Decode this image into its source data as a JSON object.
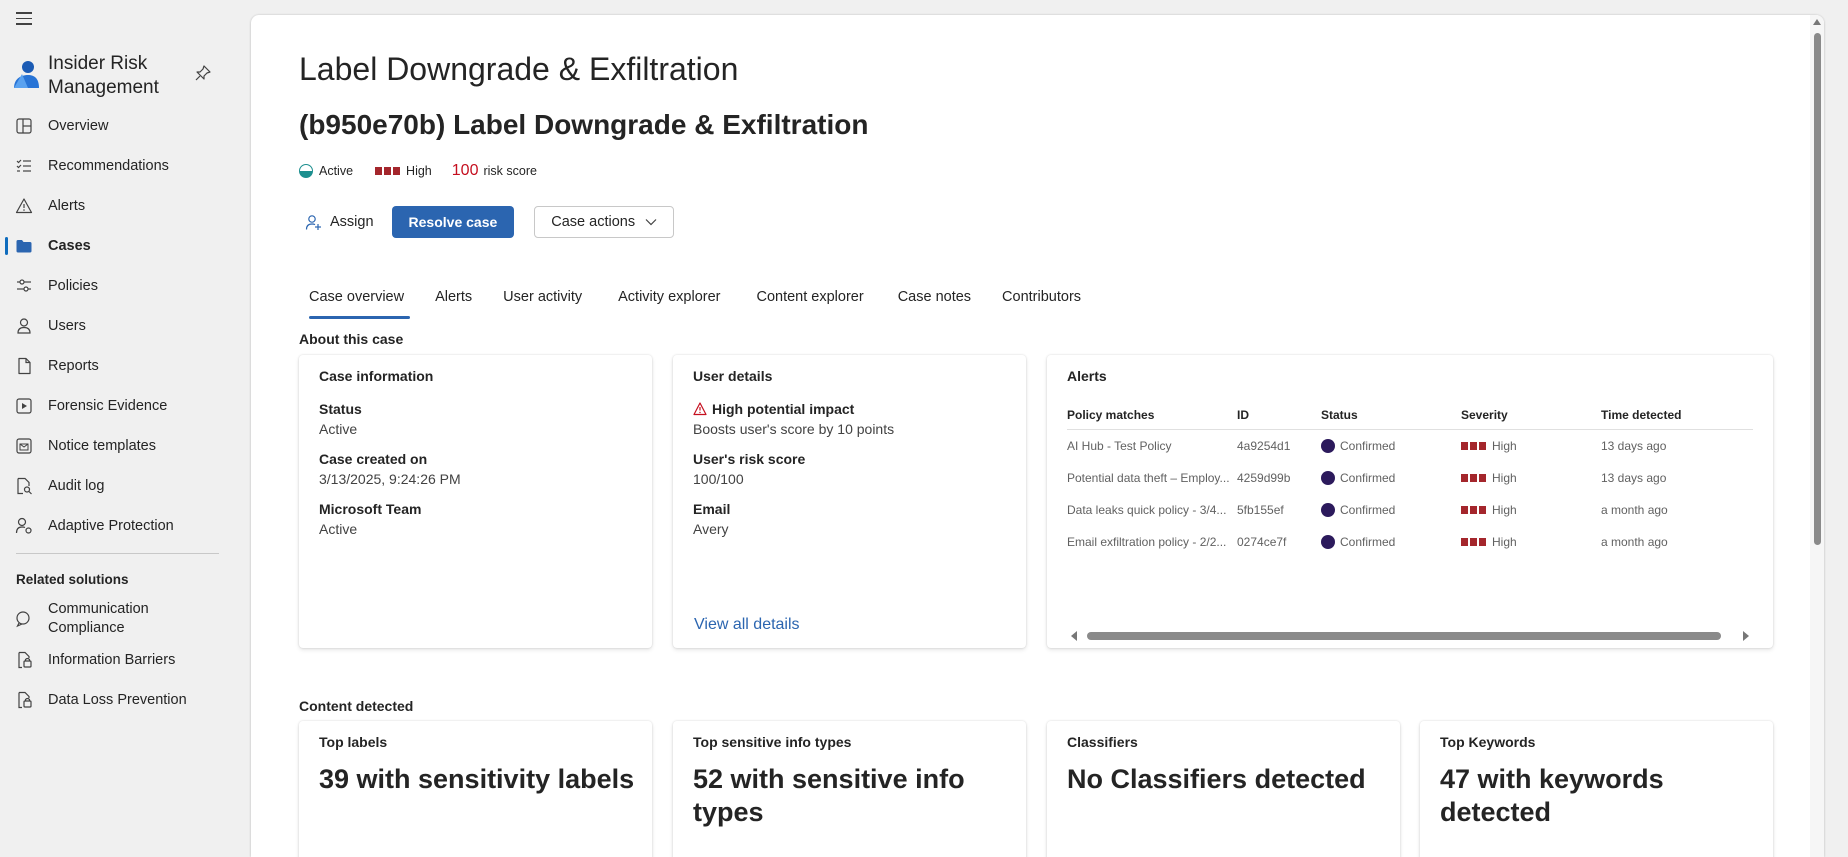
{
  "sidebar": {
    "app_title": "Insider Risk Management",
    "items": [
      {
        "label": "Overview",
        "icon": "overview-icon"
      },
      {
        "label": "Recommendations",
        "icon": "recommendations-icon"
      },
      {
        "label": "Alerts",
        "icon": "alert-triangle-icon"
      },
      {
        "label": "Cases",
        "icon": "folder-icon",
        "active": true
      },
      {
        "label": "Policies",
        "icon": "sliders-icon"
      },
      {
        "label": "Users",
        "icon": "person-icon"
      },
      {
        "label": "Reports",
        "icon": "document-icon"
      },
      {
        "label": "Forensic Evidence",
        "icon": "play-box-icon"
      },
      {
        "label": "Notice templates",
        "icon": "mail-template-icon"
      },
      {
        "label": "Audit log",
        "icon": "document-search-icon"
      },
      {
        "label": "Adaptive Protection",
        "icon": "person-settings-icon"
      }
    ],
    "related_heading": "Related solutions",
    "related": [
      {
        "label": "Communication Compliance",
        "icon": "chat-icon"
      },
      {
        "label": "Information Barriers",
        "icon": "lock-document-icon"
      },
      {
        "label": "Data Loss Prevention",
        "icon": "lock-document-icon"
      }
    ]
  },
  "page": {
    "title": "Label Downgrade & Exfiltration",
    "case_title": "(b950e70b) Label Downgrade & Exfiltration",
    "status": "Active",
    "severity": "High",
    "risk_score": "100",
    "risk_score_label": "risk score"
  },
  "actions": {
    "assign": "Assign",
    "resolve": "Resolve case",
    "case_actions": "Case actions"
  },
  "tabs": [
    "Case overview",
    "Alerts",
    "User activity",
    "Activity explorer",
    "Content explorer",
    "Case notes",
    "Contributors"
  ],
  "about": {
    "heading": "About this case",
    "case_info": {
      "title": "Case information",
      "status_label": "Status",
      "status_value": "Active",
      "created_label": "Case created on",
      "created_value": "3/13/2025, 9:24:26 PM",
      "team_label": "Microsoft Team",
      "team_value": "Active"
    },
    "user_details": {
      "title": "User details",
      "impact_label": "High potential impact",
      "impact_desc": "Boosts user's score by 10 points",
      "risk_label": "User's risk score",
      "risk_value": "100/100",
      "email_label": "Email",
      "email_value": "Avery",
      "view_all": "View all details"
    },
    "alerts": {
      "title": "Alerts",
      "columns": [
        "Policy matches",
        "ID",
        "Status",
        "Severity",
        "Time detected"
      ],
      "rows": [
        {
          "policy": "AI Hub - Test Policy",
          "id": "4a9254d1",
          "status": "Confirmed",
          "severity": "High",
          "time": "13 days ago"
        },
        {
          "policy": "Potential data theft – Employ...",
          "id": "4259d99b",
          "status": "Confirmed",
          "severity": "High",
          "time": "13 days ago"
        },
        {
          "policy": "Data leaks quick policy - 3/4...",
          "id": "5fb155ef",
          "status": "Confirmed",
          "severity": "High",
          "time": "a month ago"
        },
        {
          "policy": "Email exfiltration policy - 2/2...",
          "id": "0274ce7f",
          "status": "Confirmed",
          "severity": "High",
          "time": "a month ago"
        }
      ]
    }
  },
  "content": {
    "heading": "Content detected",
    "cards": [
      {
        "title": "Top labels",
        "value": "39 with sensitivity labels"
      },
      {
        "title": "Top sensitive info types",
        "value": "52 with sensitive info types"
      },
      {
        "title": "Classifiers",
        "value": "No Classifiers detected"
      },
      {
        "title": "Top Keywords",
        "value": "47 with keywords detected"
      }
    ]
  },
  "colors": {
    "accent": "#2b65b0",
    "severity_high": "#a4262c",
    "risk_score": "#c50f1f",
    "confirmed_dot": "#2c1a5c",
    "active_status": "#1d8f8f"
  }
}
